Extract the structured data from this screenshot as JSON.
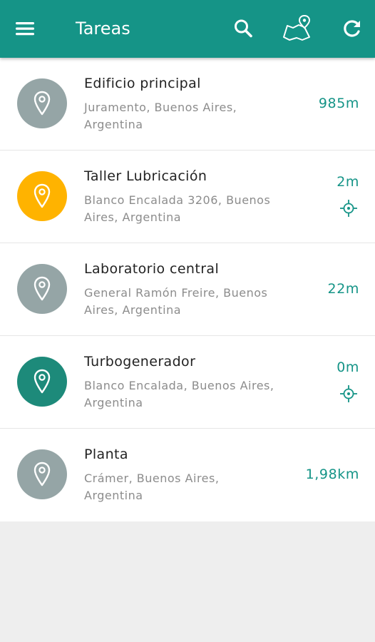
{
  "app": {
    "title": "Tareas"
  },
  "toolbar": {
    "icons": [
      "menu-icon",
      "search-icon",
      "map-pin-icon",
      "refresh-icon"
    ]
  },
  "colors": {
    "primary": "#159487",
    "avatar_gray": "#95a5a6",
    "avatar_yellow": "#ffb300",
    "avatar_teal": "#1d8a7a",
    "distance_text": "#159487"
  },
  "tasks": [
    {
      "name": "Edificio principal",
      "address": "Juramento, Buenos Aires, Argentina",
      "distance": "985m",
      "status_color": "#95a5a6",
      "show_locate": false
    },
    {
      "name": "Taller Lubricación",
      "address": "Blanco Encalada 3206, Buenos Aires, Argentina",
      "distance": "2m",
      "status_color": "#ffb300",
      "show_locate": true
    },
    {
      "name": "Laboratorio central",
      "address": "General Ramón Freire, Buenos Aires, Argentina",
      "distance": "22m",
      "status_color": "#95a5a6",
      "show_locate": false
    },
    {
      "name": "Turbogenerador",
      "address": "Blanco Encalada, Buenos Aires, Argentina",
      "distance": "0m",
      "status_color": "#1d8a7a",
      "show_locate": true
    },
    {
      "name": "Planta",
      "address": "Crámer, Buenos Aires, Argentina",
      "distance": "1,98km",
      "status_color": "#95a5a6",
      "show_locate": false
    }
  ]
}
